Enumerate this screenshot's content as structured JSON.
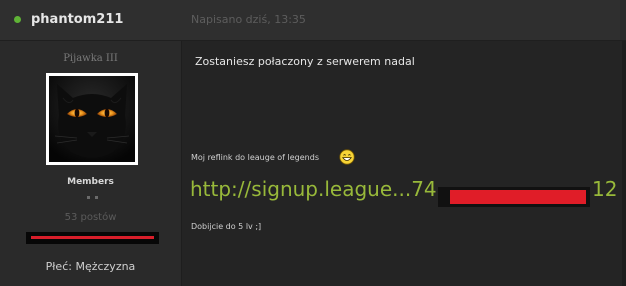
{
  "post": {
    "author": {
      "name": "phantom211",
      "online_color": "#5fb336",
      "rank_title": "Pijawka III",
      "group": "Members",
      "post_count": "53 postów",
      "gender_field": "Płeć: Mężczyzna",
      "avatar_icon": "black-cat-avatar",
      "reputation_bar_color": "#d81e2a"
    },
    "date": "Napisano dziś, 13:35",
    "body_text": "Zostaniesz połaczony z serwerem nadal",
    "signature": {
      "line1": "Moj reflink do leauge of legends",
      "emoticon": "grin-icon",
      "link_prefix": "http://signup.league...74",
      "link_suffix": "12",
      "link_color": "#98b93a",
      "redaction_color": "#e01d28",
      "line3": "Dobijcie do 5 lv ;]"
    }
  }
}
